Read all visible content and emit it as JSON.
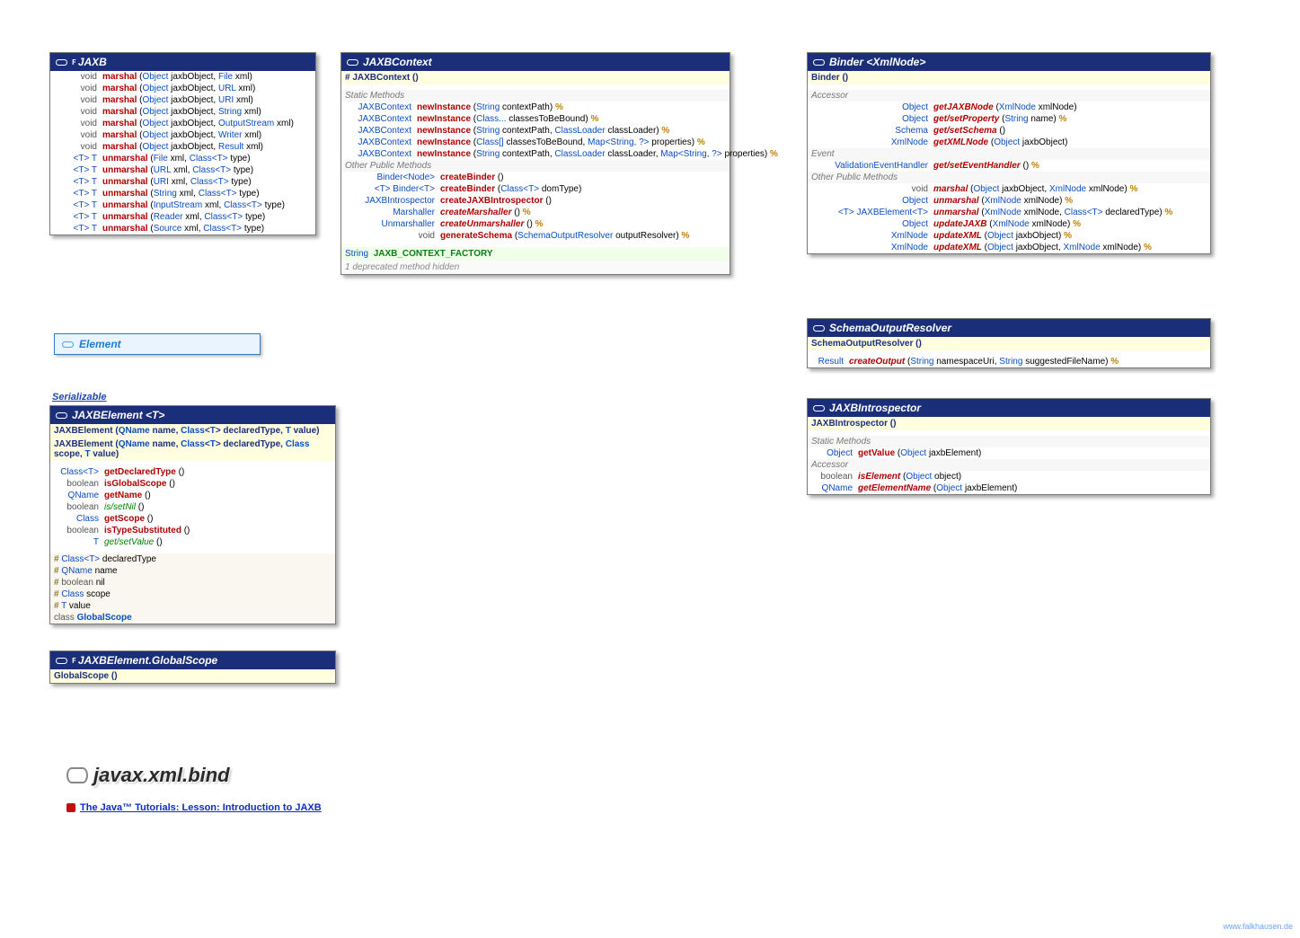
{
  "package": "javax.xml.bind",
  "tutorial_link": "The Java™ Tutorials: Lesson: Introduction to JAXB",
  "site_credit": "www.falkhausen.de",
  "interface_element": "Element",
  "serializable": "Serializable",
  "jaxb": {
    "title": "JAXB",
    "methods": [
      {
        "ret": "void",
        "rettype": "prim",
        "name": "marshal",
        "params": [
          {
            "t": "Object",
            "n": "jaxbObject"
          },
          {
            "t": "File",
            "n": "xml"
          }
        ]
      },
      {
        "ret": "void",
        "rettype": "prim",
        "name": "marshal",
        "params": [
          {
            "t": "Object",
            "n": "jaxbObject"
          },
          {
            "t": "URL",
            "n": "xml"
          }
        ]
      },
      {
        "ret": "void",
        "rettype": "prim",
        "name": "marshal",
        "params": [
          {
            "t": "Object",
            "n": "jaxbObject"
          },
          {
            "t": "URI",
            "n": "xml"
          }
        ]
      },
      {
        "ret": "void",
        "rettype": "prim",
        "name": "marshal",
        "params": [
          {
            "t": "Object",
            "n": "jaxbObject"
          },
          {
            "t": "String",
            "n": "xml"
          }
        ]
      },
      {
        "ret": "void",
        "rettype": "prim",
        "name": "marshal",
        "params": [
          {
            "t": "Object",
            "n": "jaxbObject"
          },
          {
            "t": "OutputStream",
            "n": "xml"
          }
        ]
      },
      {
        "ret": "void",
        "rettype": "prim",
        "name": "marshal",
        "params": [
          {
            "t": "Object",
            "n": "jaxbObject"
          },
          {
            "t": "Writer",
            "n": "xml"
          }
        ]
      },
      {
        "ret": "void",
        "rettype": "prim",
        "name": "marshal",
        "params": [
          {
            "t": "Object",
            "n": "jaxbObject"
          },
          {
            "t": "Result",
            "n": "xml"
          }
        ]
      },
      {
        "ret": "<T> T",
        "rettype": "type",
        "name": "unmarshal",
        "params": [
          {
            "t": "File",
            "n": "xml"
          },
          {
            "t": "Class<T>",
            "n": "type"
          }
        ]
      },
      {
        "ret": "<T> T",
        "rettype": "type",
        "name": "unmarshal",
        "params": [
          {
            "t": "URL",
            "n": "xml"
          },
          {
            "t": "Class<T>",
            "n": "type"
          }
        ]
      },
      {
        "ret": "<T> T",
        "rettype": "type",
        "name": "unmarshal",
        "params": [
          {
            "t": "URI",
            "n": "xml"
          },
          {
            "t": "Class<T>",
            "n": "type"
          }
        ]
      },
      {
        "ret": "<T> T",
        "rettype": "type",
        "name": "unmarshal",
        "params": [
          {
            "t": "String",
            "n": "xml"
          },
          {
            "t": "Class<T>",
            "n": "type"
          }
        ]
      },
      {
        "ret": "<T> T",
        "rettype": "type",
        "name": "unmarshal",
        "params": [
          {
            "t": "InputStream",
            "n": "xml"
          },
          {
            "t": "Class<T>",
            "n": "type"
          }
        ]
      },
      {
        "ret": "<T> T",
        "rettype": "type",
        "name": "unmarshal",
        "params": [
          {
            "t": "Reader",
            "n": "xml"
          },
          {
            "t": "Class<T>",
            "n": "type"
          }
        ]
      },
      {
        "ret": "<T> T",
        "rettype": "type",
        "name": "unmarshal",
        "params": [
          {
            "t": "Source",
            "n": "xml"
          },
          {
            "t": "Class<T>",
            "n": "type"
          }
        ]
      }
    ]
  },
  "jaxbcontext": {
    "title": "JAXBContext",
    "constructor": "# JAXBContext ()",
    "static_heading": "Static Methods",
    "static_methods": [
      {
        "ret": "JAXBContext",
        "name": "newInstance",
        "params": [
          {
            "t": "String",
            "n": "contextPath"
          }
        ],
        "throws": true
      },
      {
        "ret": "JAXBContext",
        "name": "newInstance",
        "params": [
          {
            "t": "Class...",
            "n": "classesToBeBound"
          }
        ],
        "throws": true
      },
      {
        "ret": "JAXBContext",
        "name": "newInstance",
        "params": [
          {
            "t": "String",
            "n": "contextPath"
          },
          {
            "t": "ClassLoader",
            "n": "classLoader"
          }
        ],
        "throws": true
      },
      {
        "ret": "JAXBContext",
        "name": "newInstance",
        "params": [
          {
            "t": "Class[]",
            "n": "classesToBeBound"
          },
          {
            "t": "Map<String, ?>",
            "n": "properties"
          }
        ],
        "throws": true
      },
      {
        "ret": "JAXBContext",
        "name": "newInstance",
        "params": [
          {
            "t": "String",
            "n": "contextPath"
          },
          {
            "t": "ClassLoader",
            "n": "classLoader"
          },
          {
            "t": "Map<String, ?>",
            "n": "properties"
          }
        ],
        "throws": true
      }
    ],
    "other_heading": "Other Public Methods",
    "other_methods": [
      {
        "ret": "Binder<Node>",
        "name": "createBinder",
        "abstract": false,
        "params": []
      },
      {
        "ret": "<T> Binder<T>",
        "name": "createBinder",
        "abstract": false,
        "params": [
          {
            "t": "Class<T>",
            "n": "domType"
          }
        ]
      },
      {
        "ret": "JAXBIntrospector",
        "name": "createJAXBIntrospector",
        "abstract": false,
        "params": []
      },
      {
        "ret": "Marshaller",
        "name": "createMarshaller",
        "abstract": true,
        "params": [],
        "throws": true
      },
      {
        "ret": "Unmarshaller",
        "name": "createUnmarshaller",
        "abstract": true,
        "params": [],
        "throws": true
      },
      {
        "ret": "void",
        "rettype": "prim",
        "name": "generateSchema",
        "abstract": false,
        "params": [
          {
            "t": "SchemaOutputResolver",
            "n": "outputResolver"
          }
        ],
        "throws": true
      }
    ],
    "constant": {
      "ret": "String",
      "name": "JAXB_CONTEXT_FACTORY"
    },
    "deprecated": "1 deprecated method hidden"
  },
  "binder": {
    "title": "Binder <XmlNode>",
    "constructor": "Binder ()",
    "accessor_heading": "Accessor",
    "accessors": [
      {
        "ret": "Object",
        "name": "getJAXBNode",
        "abstract": true,
        "params": [
          {
            "t": "XmlNode",
            "n": "xmlNode"
          }
        ]
      },
      {
        "ret": "Object",
        "name": "get/setProperty",
        "abstract": true,
        "params": [
          {
            "t": "String",
            "n": "name"
          }
        ],
        "throws": true
      },
      {
        "ret": "Schema",
        "name": "get/setSchema",
        "abstract": true,
        "params": []
      },
      {
        "ret": "XmlNode",
        "name": "getXMLNode",
        "abstract": true,
        "params": [
          {
            "t": "Object",
            "n": "jaxbObject"
          }
        ]
      }
    ],
    "event_heading": "Event",
    "events": [
      {
        "ret": "ValidationEventHandler",
        "name": "get/setEventHandler",
        "abstract": true,
        "params": [],
        "throws": true
      }
    ],
    "other_heading": "Other Public Methods",
    "others": [
      {
        "ret": "void",
        "rettype": "prim",
        "name": "marshal",
        "abstract": true,
        "params": [
          {
            "t": "Object",
            "n": "jaxbObject"
          },
          {
            "t": "XmlNode",
            "n": "xmlNode"
          }
        ],
        "throws": true
      },
      {
        "ret": "Object",
        "name": "unmarshal",
        "abstract": true,
        "params": [
          {
            "t": "XmlNode",
            "n": "xmlNode"
          }
        ],
        "throws": true
      },
      {
        "ret": "<T> JAXBElement<T>",
        "name": "unmarshal",
        "abstract": true,
        "params": [
          {
            "t": "XmlNode",
            "n": "xmlNode"
          },
          {
            "t": "Class<T>",
            "n": "declaredType"
          }
        ],
        "throws": true
      },
      {
        "ret": "Object",
        "name": "updateJAXB",
        "abstract": true,
        "params": [
          {
            "t": "XmlNode",
            "n": "xmlNode"
          }
        ],
        "throws": true
      },
      {
        "ret": "XmlNode",
        "name": "updateXML",
        "abstract": true,
        "params": [
          {
            "t": "Object",
            "n": "jaxbObject"
          }
        ],
        "throws": true
      },
      {
        "ret": "XmlNode",
        "name": "updateXML",
        "abstract": true,
        "params": [
          {
            "t": "Object",
            "n": "jaxbObject"
          },
          {
            "t": "XmlNode",
            "n": "xmlNode"
          }
        ],
        "throws": true
      }
    ]
  },
  "schemaoutputresolver": {
    "title": "SchemaOutputResolver",
    "constructor": "SchemaOutputResolver ()",
    "methods": [
      {
        "ret": "Result",
        "name": "createOutput",
        "abstract": true,
        "params": [
          {
            "t": "String",
            "n": "namespaceUri"
          },
          {
            "t": "String",
            "n": "suggestedFileName"
          }
        ],
        "throws": true
      }
    ]
  },
  "jaxbintrospector": {
    "title": "JAXBIntrospector",
    "constructor": "JAXBIntrospector ()",
    "static_heading": "Static Methods",
    "static_methods": [
      {
        "ret": "Object",
        "name": "getValue",
        "params": [
          {
            "t": "Object",
            "n": "jaxbElement"
          }
        ]
      }
    ],
    "accessor_heading": "Accessor",
    "accessors": [
      {
        "ret": "boolean",
        "rettype": "prim",
        "name": "isElement",
        "abstract": true,
        "params": [
          {
            "t": "Object",
            "n": "object"
          }
        ]
      },
      {
        "ret": "QName",
        "name": "getElementName",
        "abstract": true,
        "params": [
          {
            "t": "Object",
            "n": "jaxbElement"
          }
        ]
      }
    ]
  },
  "jaxbelement": {
    "title": "JAXBElement <T>",
    "constructors": [
      {
        "text": "JAXBElement (QName name, Class<T> declaredType, T value)"
      },
      {
        "text": "JAXBElement (QName name, Class<T> declaredType, Class scope, T value)"
      }
    ],
    "methods": [
      {
        "ret": "Class<T>",
        "name": "getDeclaredType",
        "params": []
      },
      {
        "ret": "boolean",
        "rettype": "prim",
        "name": "isGlobalScope",
        "params": []
      },
      {
        "ret": "QName",
        "name": "getName",
        "params": []
      },
      {
        "ret": "boolean",
        "rettype": "prim",
        "name": "is/setNil",
        "setter": true,
        "params": []
      },
      {
        "ret": "Class",
        "name": "getScope",
        "params": []
      },
      {
        "ret": "boolean",
        "rettype": "prim",
        "name": "isTypeSubstituted",
        "params": []
      },
      {
        "ret": "T",
        "name": "get/setValue",
        "setter": true,
        "params": []
      }
    ],
    "fields": [
      {
        "prefix": "#",
        "type": "Class<T>",
        "name": "declaredType"
      },
      {
        "prefix": "#",
        "type": "QName",
        "name": "name"
      },
      {
        "prefix": "#",
        "type": "boolean",
        "name": "nil"
      },
      {
        "prefix": "#",
        "type": "Class",
        "name": "scope"
      },
      {
        "prefix": "#",
        "type": "T",
        "name": "value"
      },
      {
        "prefix": "",
        "type": "class",
        "name": "GlobalScope",
        "nameIsType": true
      }
    ]
  },
  "globalscope": {
    "title": "JAXBElement.GlobalScope",
    "constructor": "GlobalScope ()"
  }
}
